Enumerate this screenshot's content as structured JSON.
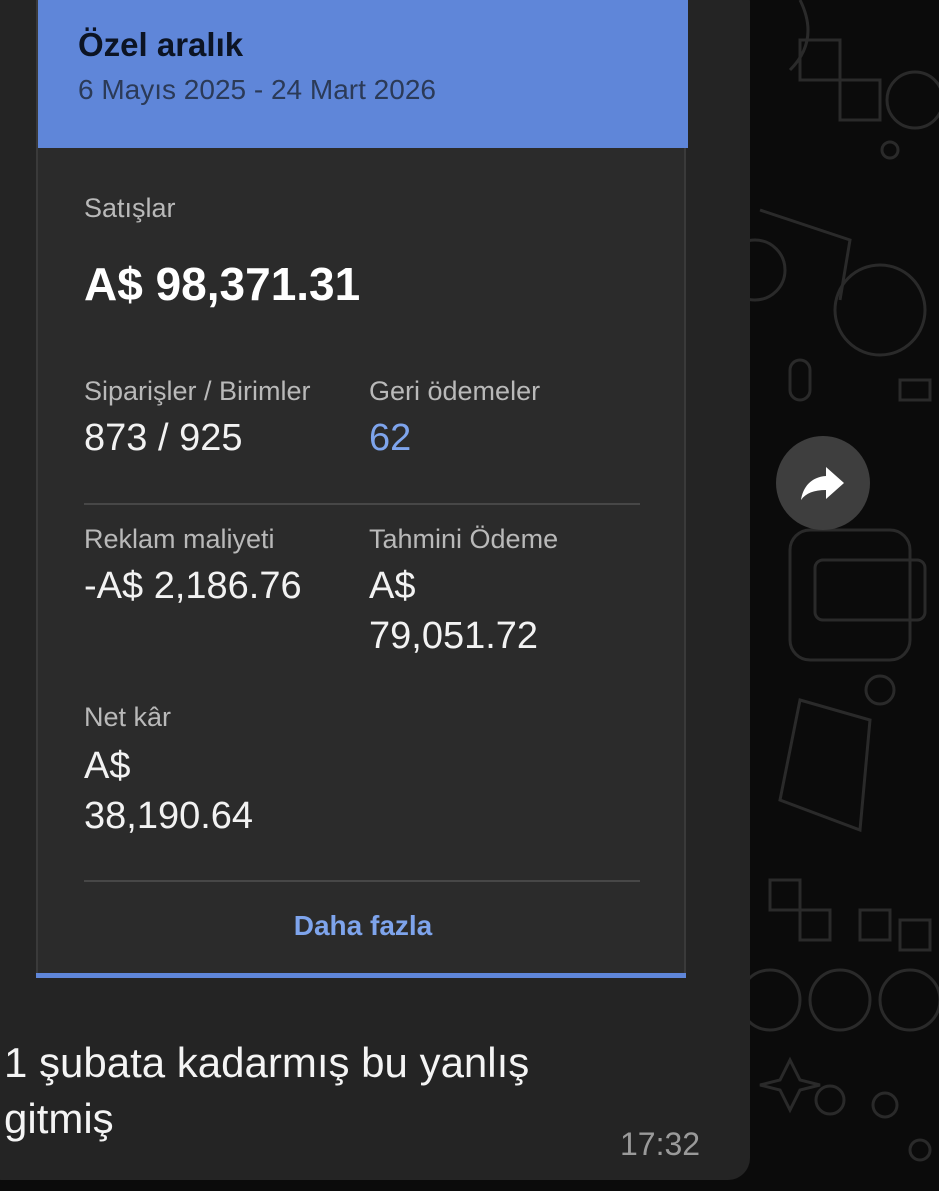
{
  "card": {
    "title": "Özel aralık",
    "date_range": "6 Mayıs 2025 - 24 Mart 2026",
    "sales_label": "Satışlar",
    "sales_value": "A$ 98,371.31",
    "orders_label": "Siparişler / Birimler",
    "orders_value": "873 / 925",
    "refunds_label": "Geri ödemeler",
    "refunds_value": "62",
    "ad_cost_label": "Reklam maliyeti",
    "ad_cost_value": "-A$ 2,186.76",
    "payout_label": "Tahmini Ödeme",
    "payout_currency": "A$",
    "payout_amount": "79,051.72",
    "net_profit_label": "Net kâr",
    "net_profit_currency": "A$",
    "net_profit_amount": "38,190.64",
    "more_label": "Daha fazla"
  },
  "message": {
    "text_line1": "1 şubata kadarmış bu yanlış",
    "text_line2": "gitmiş",
    "time": "17:32"
  },
  "icons": {
    "forward": "forward-arrow-icon"
  },
  "colors": {
    "header_blue": "#5f86d9",
    "link_blue": "#7ea4ec",
    "bubble_bg": "#242424",
    "card_bg": "#2b2b2b"
  }
}
